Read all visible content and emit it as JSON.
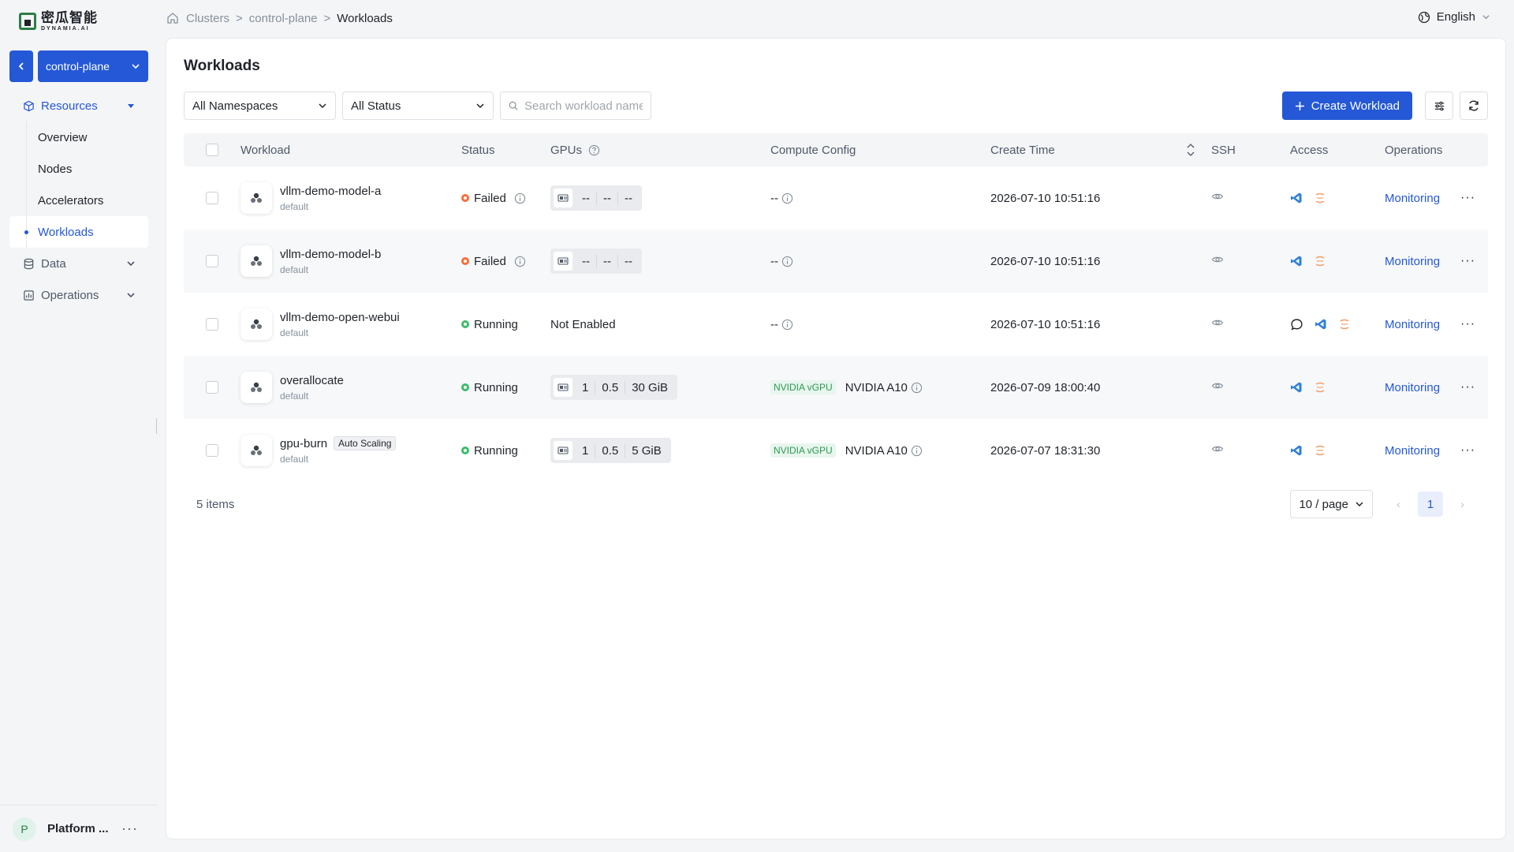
{
  "brand": {
    "name_cn": "密瓜智能",
    "name_en": "DYNAMIA.AI"
  },
  "cluster": {
    "current": "control-plane"
  },
  "breadcrumb": [
    "Clusters",
    "control-plane",
    "Workloads"
  ],
  "language": "English",
  "sidebar": {
    "groups": [
      {
        "label": "Resources",
        "icon": "cube-icon",
        "expanded": true
      },
      {
        "label": "Data",
        "icon": "database-icon",
        "expanded": false
      },
      {
        "label": "Operations",
        "icon": "chart-icon",
        "expanded": false
      }
    ],
    "resources_items": [
      "Overview",
      "Nodes",
      "Accelerators",
      "Workloads"
    ],
    "active_item": "Workloads",
    "user": {
      "initial": "P",
      "name": "Platform ..."
    }
  },
  "page": {
    "title": "Workloads",
    "filters": {
      "namespace": "All Namespaces",
      "status": "All Status",
      "search_placeholder": "Search workload name"
    },
    "create_button": "Create Workload"
  },
  "table": {
    "headers": {
      "workload": "Workload",
      "status": "Status",
      "gpus": "GPUs",
      "compute_config": "Compute Config",
      "create_time": "Create Time",
      "ssh": "SSH",
      "access": "Access",
      "operations": "Operations"
    },
    "rows": [
      {
        "name": "vllm-demo-model-a",
        "namespace": "default",
        "tag": "",
        "status": "Failed",
        "gpus": [
          "--",
          "--",
          "--"
        ],
        "gpus_text": "",
        "vgpu": "",
        "compute": "--",
        "create_time": "2026-07-10 10:51:16",
        "chat": false,
        "action": "Monitoring"
      },
      {
        "name": "vllm-demo-model-b",
        "namespace": "default",
        "tag": "",
        "status": "Failed",
        "gpus": [
          "--",
          "--",
          "--"
        ],
        "gpus_text": "",
        "vgpu": "",
        "compute": "--",
        "create_time": "2026-07-10 10:51:16",
        "chat": false,
        "action": "Monitoring"
      },
      {
        "name": "vllm-demo-open-webui",
        "namespace": "default",
        "tag": "",
        "status": "Running",
        "gpus": [],
        "gpus_text": "Not Enabled",
        "vgpu": "",
        "compute": "--",
        "create_time": "2026-07-10 10:51:16",
        "chat": true,
        "action": "Monitoring"
      },
      {
        "name": "overallocate",
        "namespace": "default",
        "tag": "",
        "status": "Running",
        "gpus": [
          "1",
          "0.5",
          "30 GiB"
        ],
        "gpus_text": "",
        "vgpu": "NVIDIA vGPU",
        "compute": "NVIDIA A10",
        "create_time": "2026-07-09 18:00:40",
        "chat": false,
        "action": "Monitoring"
      },
      {
        "name": "gpu-burn",
        "namespace": "default",
        "tag": "Auto Scaling",
        "status": "Running",
        "gpus": [
          "1",
          "0.5",
          "5 GiB"
        ],
        "gpus_text": "",
        "vgpu": "NVIDIA vGPU",
        "compute": "NVIDIA A10",
        "create_time": "2026-07-07 18:31:30",
        "chat": false,
        "action": "Monitoring"
      }
    ]
  },
  "pagination": {
    "total": "5 items",
    "page_size": "10 / page",
    "current_page": "1"
  },
  "colors": {
    "primary": "#2458d6",
    "failed": "#f76d3b",
    "running": "#3dbb6c",
    "vgpu": "#2d9a54"
  }
}
